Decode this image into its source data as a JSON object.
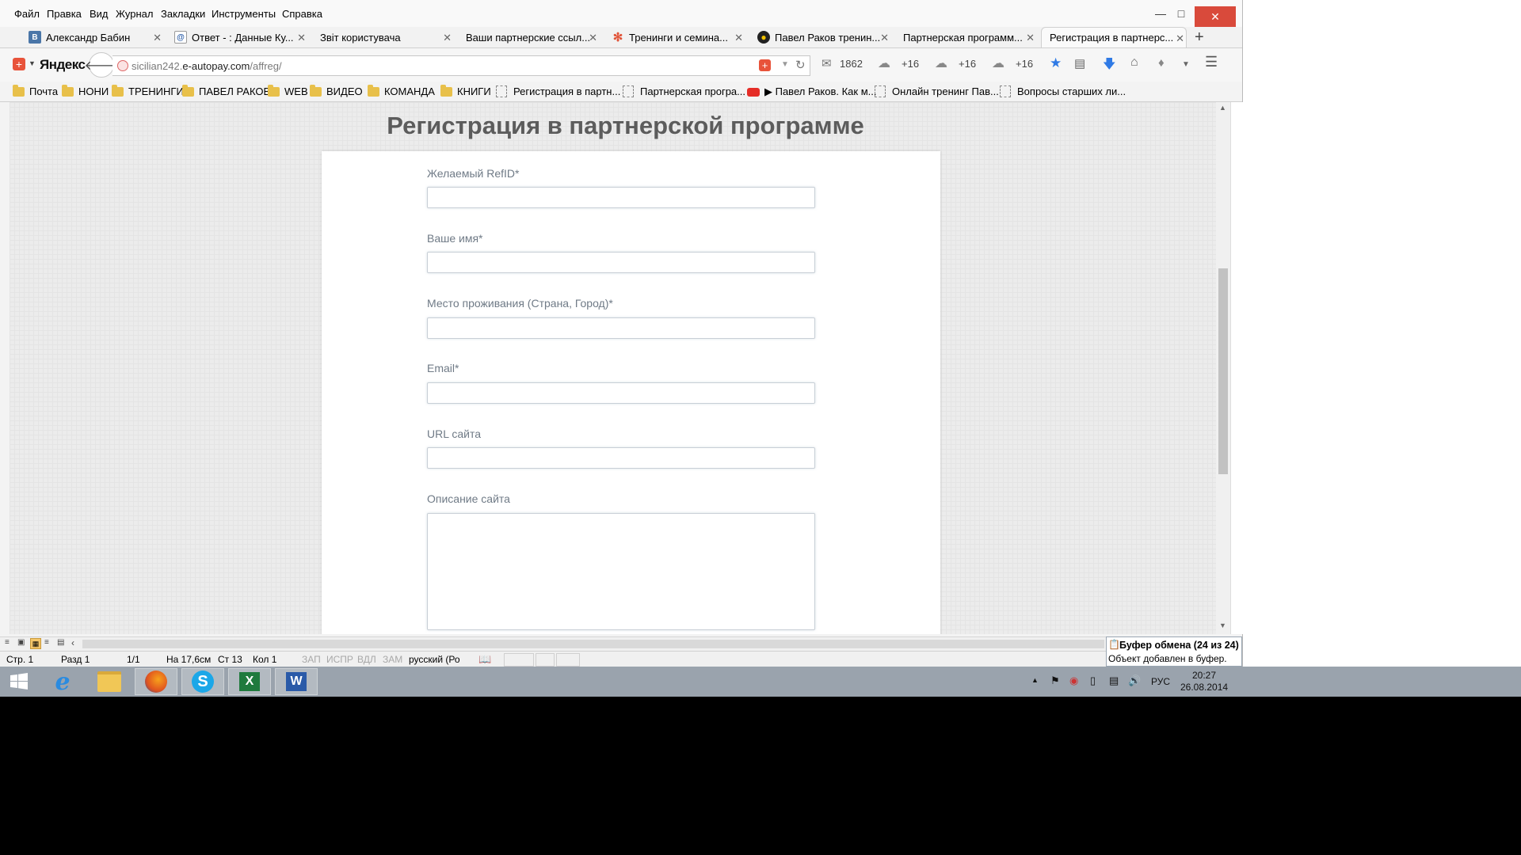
{
  "menu": [
    "Файл",
    "Правка",
    "Вид",
    "Журнал",
    "Закладки",
    "Инструменты",
    "Справка"
  ],
  "tabs": [
    {
      "label": "Александр Бабин",
      "icon": "vk-icon",
      "color": "#4a76a8",
      "glyph": "В"
    },
    {
      "label": "Ответ - : Данные Ку...",
      "icon": "mail-at-icon",
      "color": "#2a5da8",
      "glyph": "@"
    },
    {
      "label": "Звіт користувача",
      "icon": "",
      "color": "",
      "glyph": ""
    },
    {
      "label": "Ваши партнерские ссыл...",
      "icon": "",
      "color": "",
      "glyph": ""
    },
    {
      "label": "Тренинги и семина...",
      "icon": "joomla-icon",
      "color": "#e1553a",
      "glyph": "✻"
    },
    {
      "label": "Павел Раков тренин...",
      "icon": "site-logo-icon",
      "color": "#1d7a2e",
      "glyph": "●"
    },
    {
      "label": "Партнерская программ...",
      "icon": "",
      "color": "",
      "glyph": ""
    },
    {
      "label": "Регистрация в партнерс...",
      "icon": "",
      "color": "",
      "glyph": ""
    }
  ],
  "nav": {
    "brand": "Яндекс",
    "url_prefix": "sicilian242.",
    "url_domain": "e-autopay.com",
    "url_path": "/affreg/",
    "mail_count": "1862",
    "weather": [
      "+16",
      "+16",
      "+16"
    ]
  },
  "bookmarks": [
    {
      "label": "Почта",
      "type": "folder"
    },
    {
      "label": "НОНИ",
      "type": "folder"
    },
    {
      "label": "ТРЕНИНГИ",
      "type": "folder"
    },
    {
      "label": "ПАВЕЛ РАКОВ",
      "type": "folder"
    },
    {
      "label": "WEB",
      "type": "folder"
    },
    {
      "label": "ВИДЕО",
      "type": "folder"
    },
    {
      "label": "КОМАНДА",
      "type": "folder"
    },
    {
      "label": "КНИГИ",
      "type": "folder"
    },
    {
      "label": "Регистрация в партн...",
      "type": "page"
    },
    {
      "label": "Партнерская програ...",
      "type": "page"
    },
    {
      "label": "▶ Павел Раков. Как м...",
      "type": "youtube"
    },
    {
      "label": "Онлайн тренинг Пав...",
      "type": "page"
    },
    {
      "label": "Вопросы старших ли...",
      "type": "page"
    }
  ],
  "page": {
    "title": "Регистрация в партнерской программе",
    "fields": [
      {
        "label": "Желаемый RefID*",
        "value": ""
      },
      {
        "label": "Ваше имя*",
        "value": ""
      },
      {
        "label": "Место проживания (Страна, Город)*",
        "value": ""
      },
      {
        "label": "Email*",
        "value": ""
      },
      {
        "label": "URL сайта",
        "value": ""
      },
      {
        "label": "Описание сайта",
        "value": ""
      }
    ]
  },
  "word_status": {
    "page": "Стр. 1",
    "section": "Разд 1",
    "pages": "1/1",
    "position": "На 17,6см",
    "line": "Ст 13",
    "col": "Кол 1",
    "rec": "ЗАП",
    "trk": "ИСПР",
    "ext": "ВДЛ",
    "ovr": "ЗАМ",
    "lang": "русский (Ро"
  },
  "clipboard": {
    "title": "Буфер обмена (24 из 24)",
    "message": "Объект добавлен в буфер."
  },
  "taskbar": {
    "lang": "РУС",
    "time": "20:27",
    "date": "26.08.2014"
  }
}
